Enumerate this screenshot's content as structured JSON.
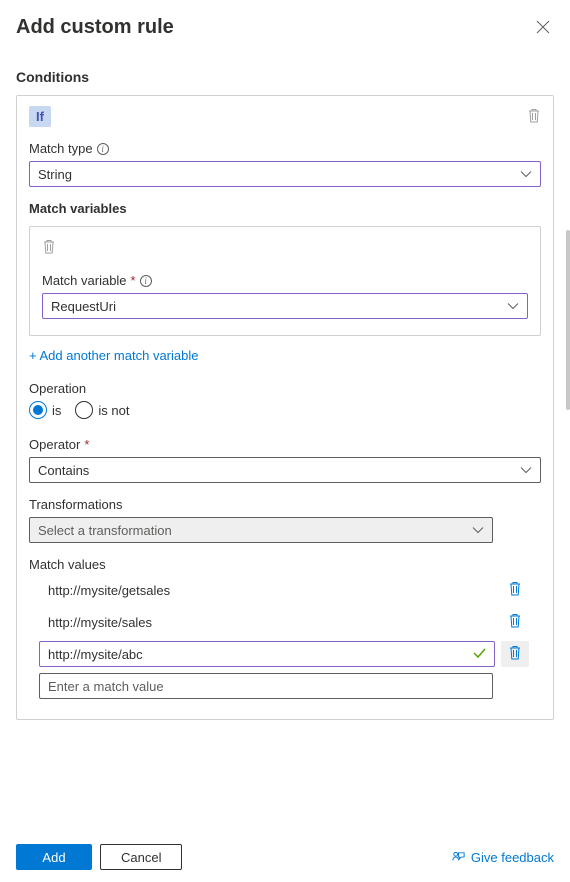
{
  "header": {
    "title": "Add custom rule"
  },
  "sections": {
    "conditions": "Conditions",
    "matchVariables": "Match variables",
    "matchValues": "Match values",
    "transformations": "Transformations"
  },
  "ifBadge": "If",
  "fields": {
    "matchType": {
      "label": "Match type",
      "value": "String"
    },
    "matchVariable": {
      "label": "Match variable",
      "value": "RequestUri"
    },
    "operation": {
      "label": "Operation",
      "options": {
        "is": "is",
        "isNot": "is not"
      },
      "selected": "is"
    },
    "operator": {
      "label": "Operator",
      "value": "Contains"
    },
    "transformation": {
      "placeholder": "Select a transformation"
    }
  },
  "links": {
    "addVariable": "+ Add another match variable"
  },
  "matchValues": {
    "items": [
      "http://mysite/getsales",
      "http://mysite/sales",
      "http://mysite/abc"
    ],
    "editingIndex": 2,
    "inputPlaceholder": "Enter a match value"
  },
  "footer": {
    "add": "Add",
    "cancel": "Cancel",
    "feedback": "Give feedback"
  }
}
